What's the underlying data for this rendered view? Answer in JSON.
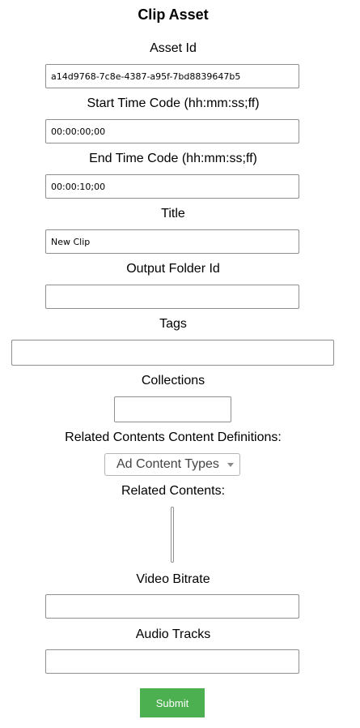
{
  "form": {
    "title": "Clip Asset",
    "asset_id": {
      "label": "Asset Id",
      "value": "a14d9768-7c8e-4387-a95f-7bd8839647b5"
    },
    "start_time_code": {
      "label": "Start Time Code (hh:mm:ss;ff)",
      "value": "00:00:00;00"
    },
    "end_time_code": {
      "label": "End Time Code (hh:mm:ss;ff)",
      "value": "00:00:10;00"
    },
    "clip_title": {
      "label": "Title",
      "value": "New Clip"
    },
    "output_folder_id": {
      "label": "Output Folder Id",
      "value": ""
    },
    "tags": {
      "label": "Tags",
      "value": ""
    },
    "collections": {
      "label": "Collections",
      "value": ""
    },
    "related_content_definitions": {
      "label": "Related Contents Content Definitions:",
      "selected": "Ad Content Types"
    },
    "related_contents": {
      "label": "Related Contents:"
    },
    "video_bitrate": {
      "label": "Video Bitrate",
      "value": ""
    },
    "audio_tracks": {
      "label": "Audio Tracks",
      "value": ""
    },
    "submit_label": "Submit",
    "submit_color": "#4caf50"
  }
}
